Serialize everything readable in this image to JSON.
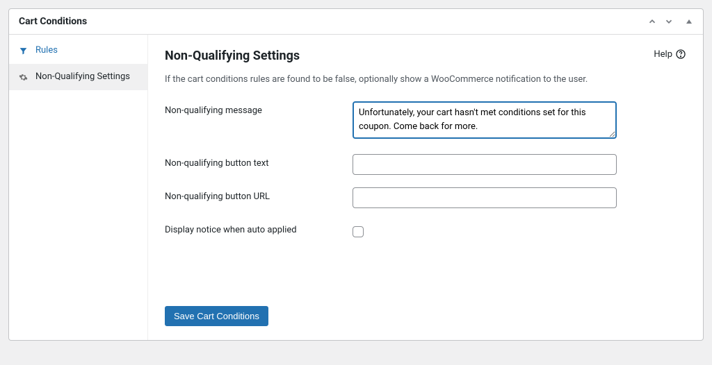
{
  "panel": {
    "title": "Cart Conditions"
  },
  "sidebar": {
    "items": [
      {
        "label": "Rules"
      },
      {
        "label": "Non-Qualifying Settings"
      }
    ]
  },
  "main": {
    "title": "Non-Qualifying Settings",
    "help_label": "Help",
    "description": "If the cart conditions rules are found to be false, optionally show a WooCommerce notification to the user.",
    "fields": {
      "message_label": "Non-qualifying message",
      "message_value": "Unfortunately, your cart hasn't met conditions set for this coupon. Come back for more.",
      "button_text_label": "Non-qualifying button text",
      "button_text_value": "",
      "button_url_label": "Non-qualifying button URL",
      "button_url_value": "",
      "display_notice_label": "Display notice when auto applied",
      "display_notice_checked": false
    },
    "save_button": "Save Cart Conditions"
  }
}
